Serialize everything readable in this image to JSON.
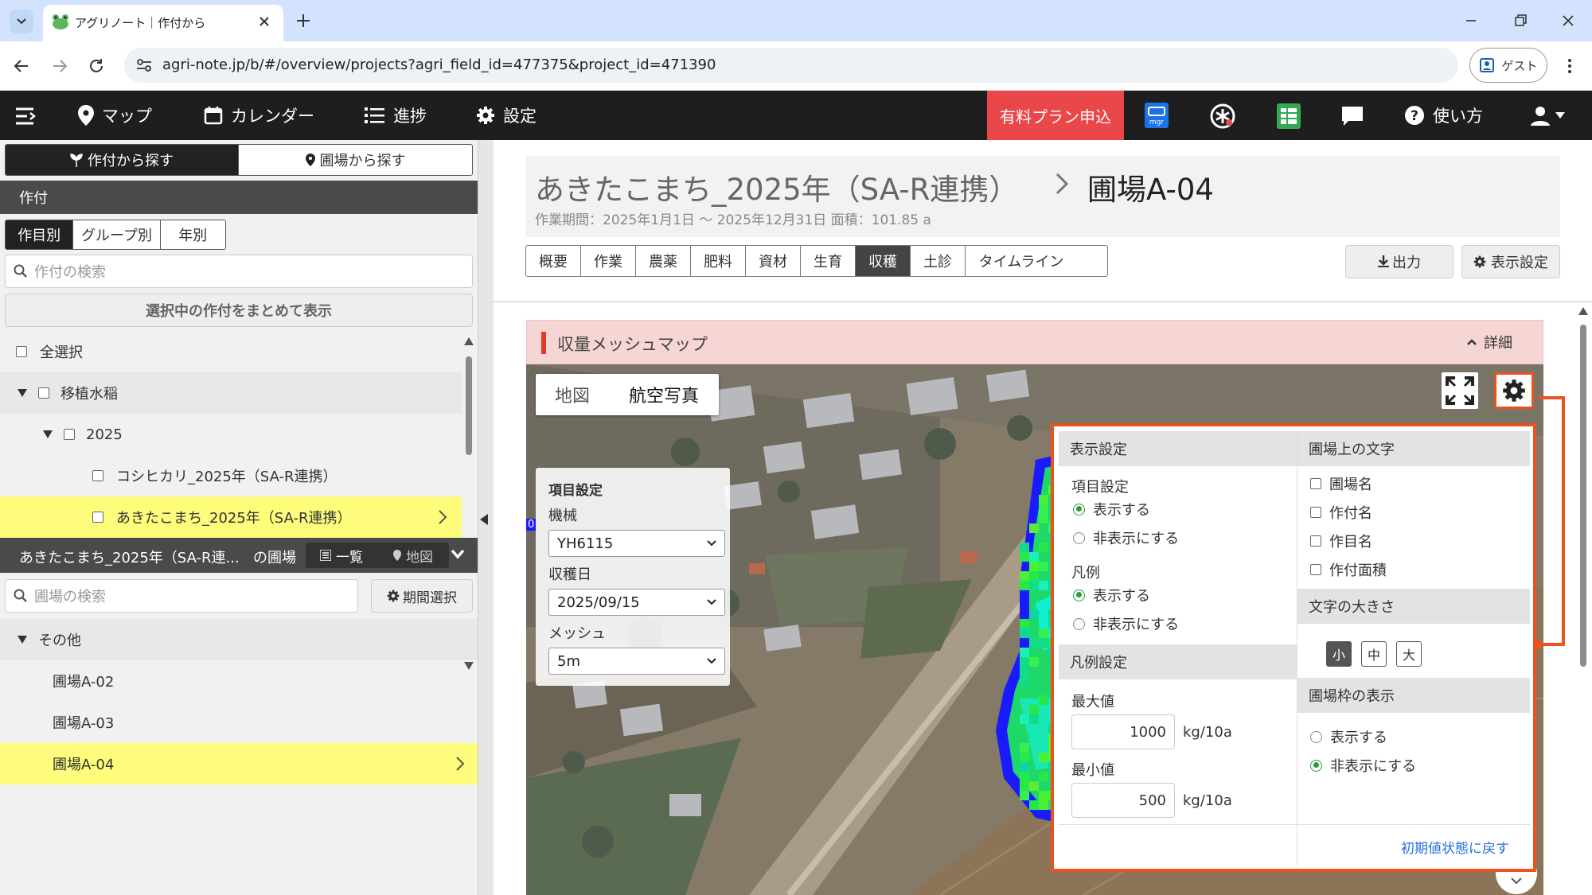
{
  "browser": {
    "tab_title": "アグリノート｜作付から",
    "url": "agri-note.jp/b/#/overview/projects?agri_field_id=477375&project_id=471390",
    "guest_label": "ゲスト"
  },
  "nav": {
    "map": "マップ",
    "calendar": "カレンダー",
    "progress": "進捗",
    "settings": "設定",
    "paid_plan": "有料プラン申込",
    "help": "使い方",
    "mgr_label": "mgr"
  },
  "sidebar": {
    "search_by_crop": "作付から探す",
    "search_by_field": "圃場から探す",
    "section_title": "作付",
    "tabs": [
      "作目別",
      "グループ別",
      "年別"
    ],
    "crop_search_placeholder": "作付の検索",
    "show_selected": "選択中の作付をまとめて表示",
    "select_all": "全選択",
    "tree": {
      "group": "移植水稲",
      "year": "2025",
      "crops": [
        "コシヒカリ_2025年（SA-R連携）",
        "あきたこまち_2025年（SA-R連携）"
      ]
    },
    "field_panel": {
      "title": "あきたこまち_2025年（SA-R連...",
      "title_suffix": "の圃場",
      "list_btn": "一覧",
      "map_btn": "地図",
      "search_placeholder": "圃場の検索",
      "period_btn": "期間選択",
      "group": "その他",
      "fields": [
        "圃場A-02",
        "圃場A-03",
        "圃場A-04"
      ]
    }
  },
  "header": {
    "crop_title": "あきたこまち_2025年（SA-R連携）",
    "field_title": "圃場A-04",
    "meta": "作業期間：2025年1月1日 〜 2025年12月31日 面積：101.85 a",
    "tabs": [
      "概要",
      "作業",
      "農薬",
      "肥料",
      "資材",
      "生育",
      "収穫",
      "土診",
      "タイムライン"
    ],
    "active_tab": "収穫",
    "export_btn": "出力",
    "display_settings_btn": "表示設定"
  },
  "panel": {
    "title": "収量メッシュマップ",
    "detail": "詳細"
  },
  "map": {
    "layer_map": "地図",
    "layer_aerial": "航空写真",
    "item_settings": {
      "title": "項目設定",
      "machine_label": "機械",
      "machine_value": "YH6115",
      "harvest_date_label": "収穫日",
      "harvest_date_value": "2025/09/15",
      "mesh_label": "メッシュ",
      "mesh_value": "5m"
    },
    "side_marker": "0"
  },
  "settings_popup": {
    "display_settings": "表示設定",
    "item_settings": "項目設定",
    "show": "表示する",
    "hide": "非表示にする",
    "legend": "凡例",
    "legend_settings": "凡例設定",
    "max_label": "最大値",
    "max_value": "1000",
    "min_label": "最小値",
    "min_value": "500",
    "unit": "kg/10a",
    "text_on_field": "圃場上の文字",
    "text_options": [
      "圃場名",
      "作付名",
      "作目名",
      "作付面積"
    ],
    "text_size": "文字の大きさ",
    "sizes": [
      "小",
      "中",
      "大"
    ],
    "field_frame": "圃場枠の表示",
    "reset": "初期値状態に戻す"
  }
}
